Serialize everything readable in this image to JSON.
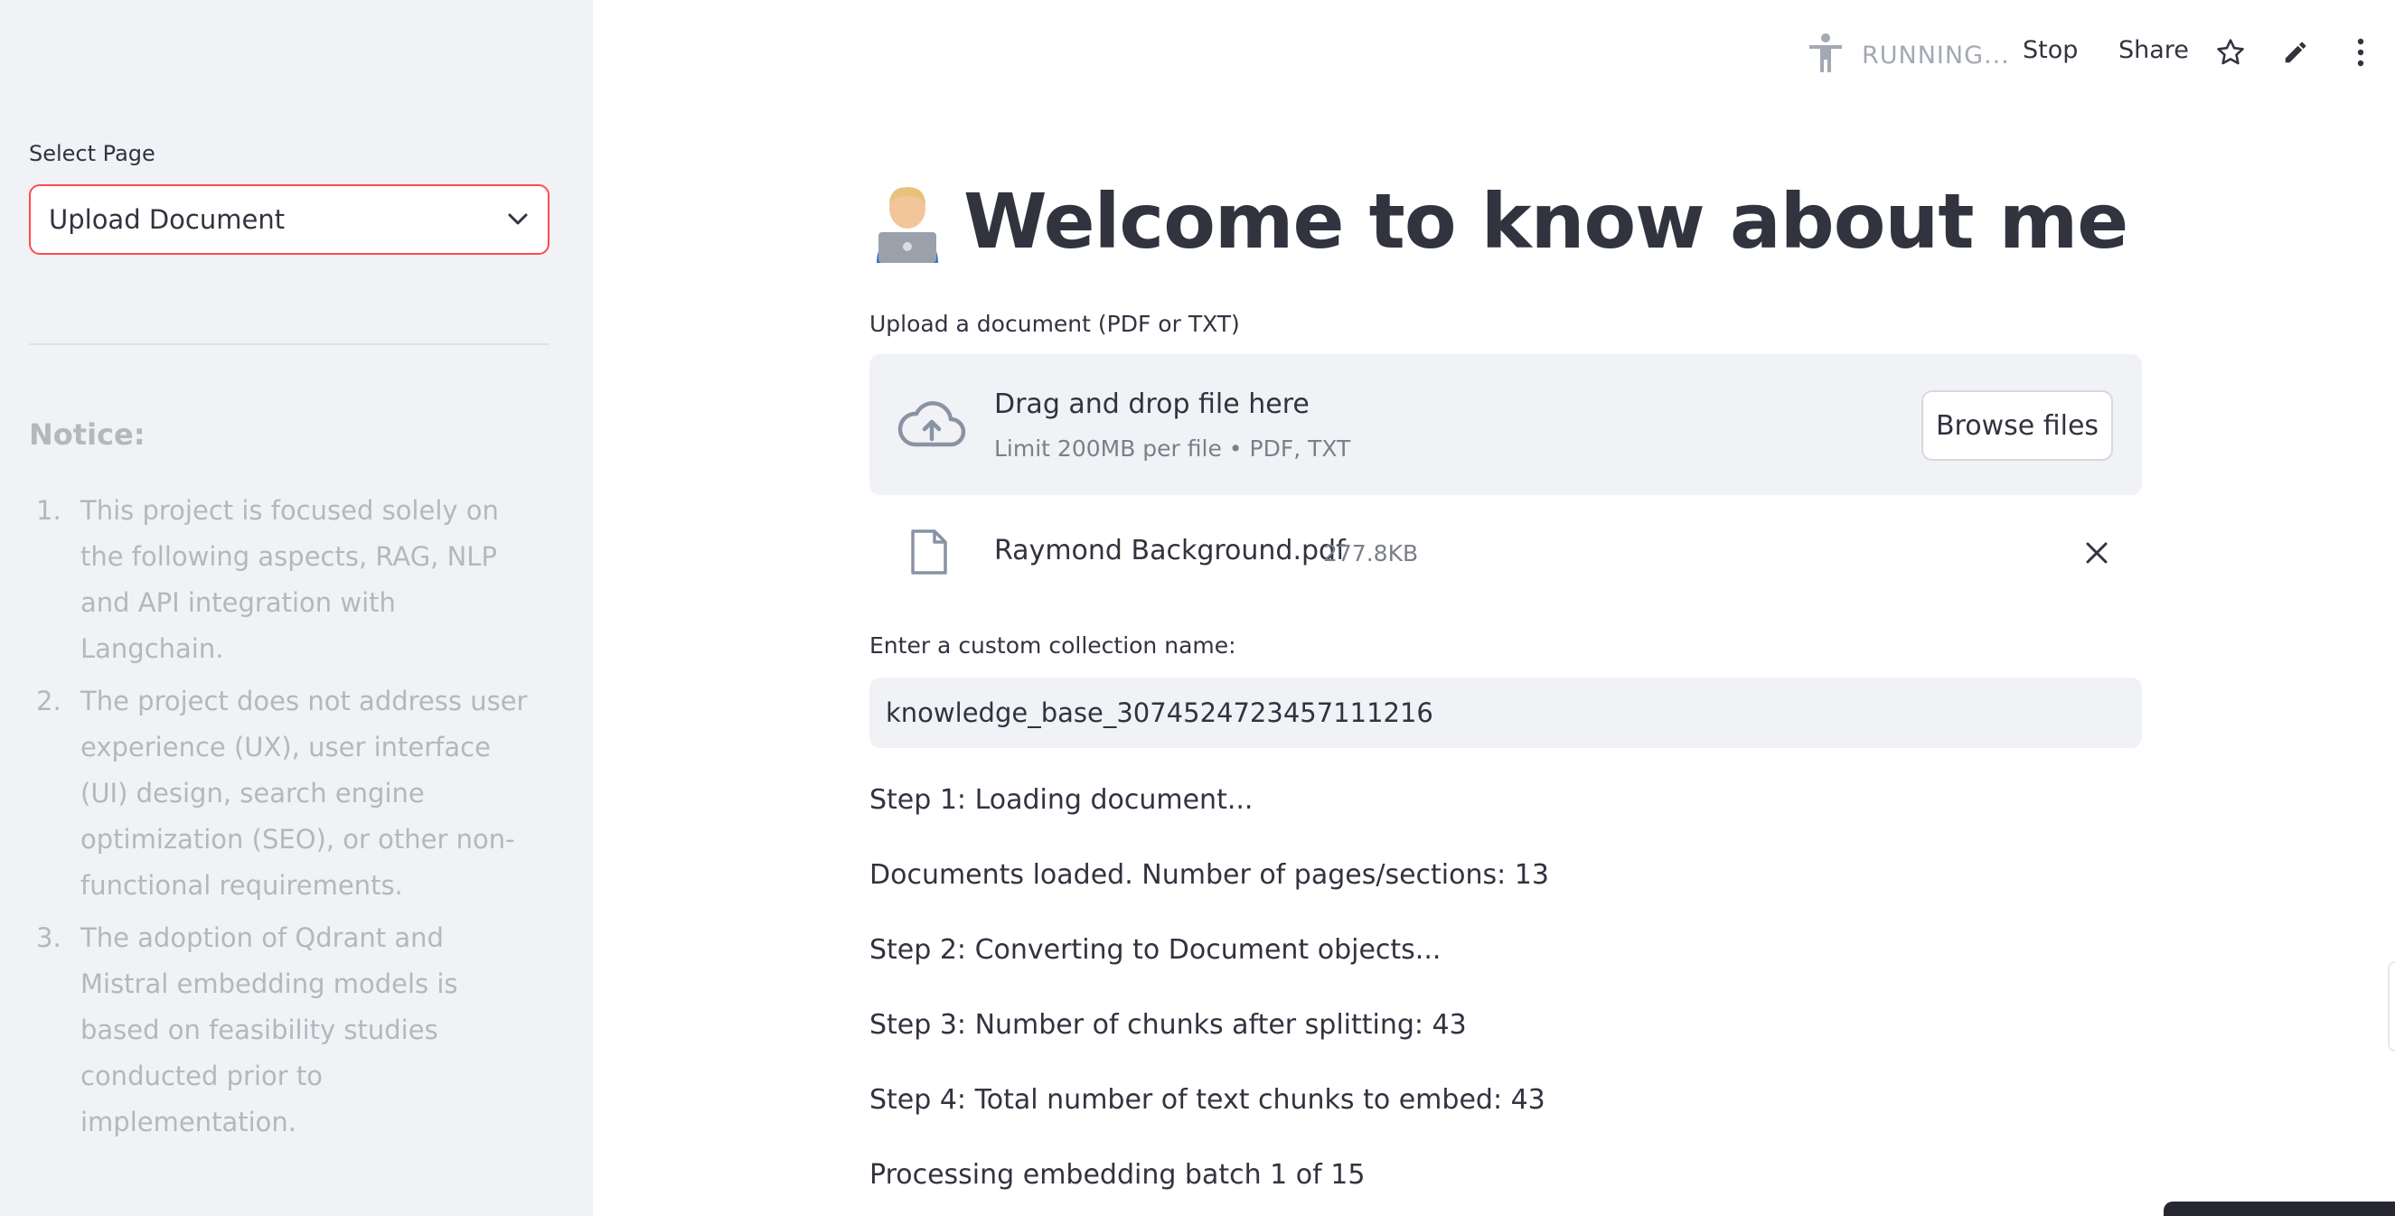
{
  "sidebar": {
    "select_label": "Select Page",
    "select_value": "Upload Document",
    "notice_title": "Notice:",
    "notice_items": [
      {
        "num": "1.",
        "text": "This project is focused solely on the following aspects, RAG, NLP and API integration with Langchain."
      },
      {
        "num": "2.",
        "text": "The project does not address user experience (UX), user interface (UI) design, search engine optimization (SEO), or other non-functional requirements."
      },
      {
        "num": "3.",
        "text": "The adoption of Qdrant and Mistral embedding models is based on feasibility studies conducted prior to implementation."
      }
    ]
  },
  "toolbar": {
    "running_text": "RUNNING...",
    "stop_label": "Stop",
    "share_label": "Share"
  },
  "main": {
    "title": "Welcome to know about me",
    "upload_label": "Upload a document (PDF or TXT)",
    "dropzone_main": "Drag and drop file here",
    "dropzone_sub": "Limit 200MB per file • PDF, TXT",
    "browse_label": "Browse files",
    "file_name": "Raymond Background.pdf",
    "file_size": "277.8KB",
    "collection_label": "Enter a custom collection name:",
    "collection_value": "knowledge_base_3074524723457111216",
    "log": [
      "Step 1: Loading document...",
      "Documents loaded. Number of pages/sections: 13",
      "Step 2: Converting to Document objects...",
      "Step 3: Number of chunks after splitting: 43",
      "Step 4: Total number of text chunks to embed: 43",
      "Processing embedding batch 1 of 15"
    ]
  },
  "colors": {
    "accent": "#ff4b4b",
    "text": "#31333f",
    "muted": "#b5b7bd",
    "panel": "#f0f2f6"
  }
}
